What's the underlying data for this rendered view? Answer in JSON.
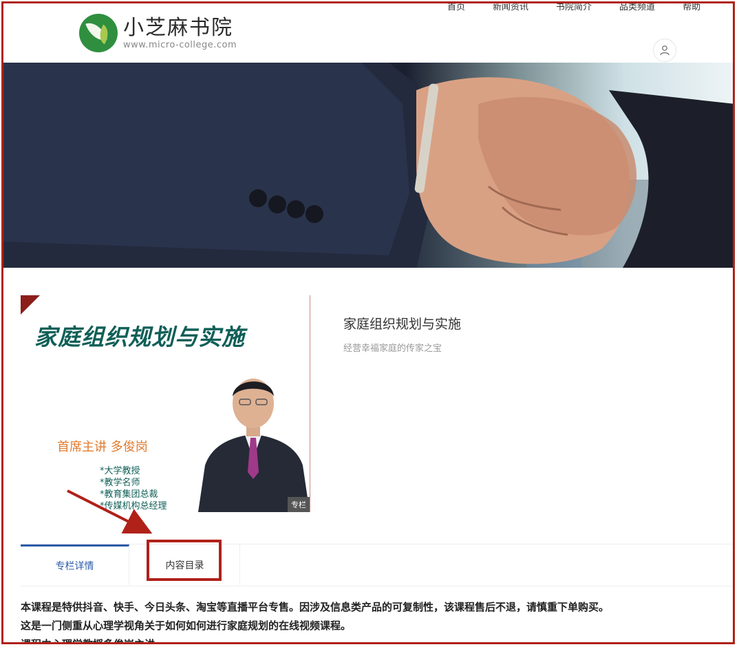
{
  "brand": {
    "name": "小芝麻书院",
    "url": "www.micro-college.com"
  },
  "nav": {
    "items": [
      "首页",
      "新闻资讯",
      "书院简介",
      "品类频道",
      "帮助"
    ]
  },
  "cover": {
    "title": "家庭组织规划与实施",
    "host": "首席主讲 多俊岗",
    "credentials": [
      "*大学教授",
      "*教学名师",
      "*教育集团总裁",
      "*传媒机构总经理"
    ],
    "badge": "专栏"
  },
  "product": {
    "title": "家庭组织规划与实施",
    "subtitle": "经营幸福家庭的传家之宝"
  },
  "tabs": {
    "detail": "专栏详情",
    "catalog": "内容目录"
  },
  "description": [
    "本课程是特供抖音、快手、今日头条、淘宝等直播平台专售。因涉及信息类产品的可复制性，该课程售后不退，请慎重下单购买。",
    "这是一门侧重从心理学视角关于如何如何进行家庭规划的在线视频课程。",
    "课程由心理学教授多俊岗主讲"
  ],
  "colors": {
    "annotation": "#b0211a",
    "tab_active": "#2b5aa8",
    "cover_title": "#0f5f57",
    "cover_host": "#e07b2e"
  },
  "icons": {
    "user": "user-icon",
    "logo": "leaf-logo-icon"
  }
}
